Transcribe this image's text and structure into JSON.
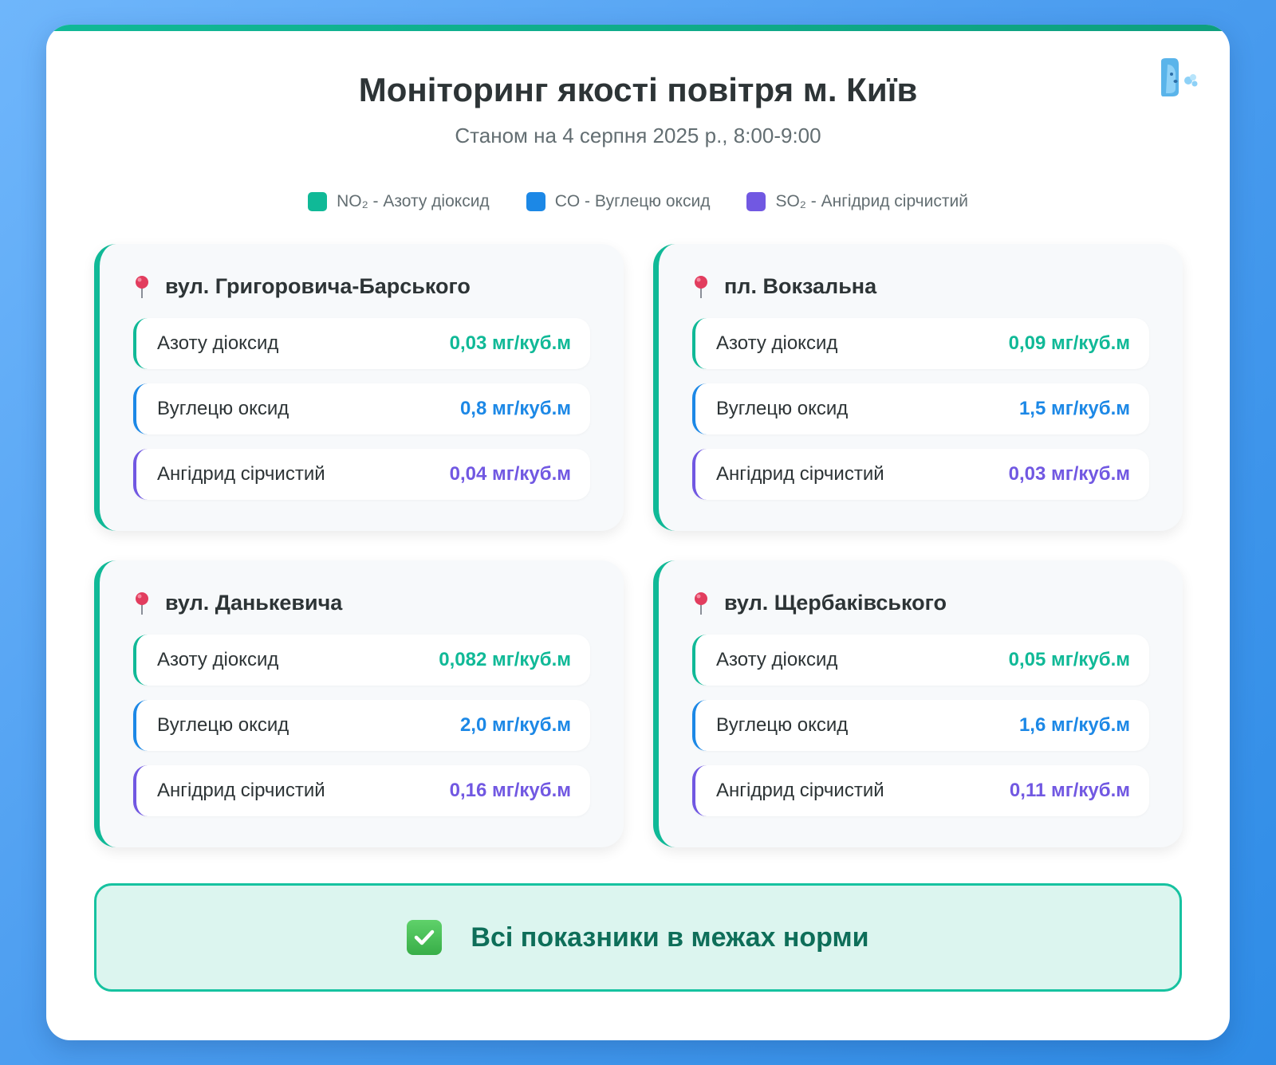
{
  "header": {
    "title": "Моніторинг якості повітря м. Київ",
    "subtitle": "Станом на 4 серпня 2025 р., 8:00-9:00"
  },
  "legend": [
    {
      "label": "NO₂ - Азоту діоксид",
      "color": "#10b997"
    },
    {
      "label": "CO - Вуглецю оксид",
      "color": "#1c88e6"
    },
    {
      "label": "SO₂ - Ангідрид сірчистий",
      "color": "#7158e2"
    }
  ],
  "icons": {
    "logo": "face-wind-icon",
    "location": "round-pushpin-icon",
    "status": "check-mark-button-icon"
  },
  "stations": [
    {
      "name": "вул. Григоровича-Барського",
      "rows": [
        {
          "label": "Азоту діоксид",
          "value": "0,03 мг/куб.м"
        },
        {
          "label": "Вуглецю оксид",
          "value": "0,8 мг/куб.м"
        },
        {
          "label": "Ангідрид сірчистий",
          "value": "0,04 мг/куб.м"
        }
      ]
    },
    {
      "name": "пл. Вокзальна",
      "rows": [
        {
          "label": "Азоту діоксид",
          "value": "0,09 мг/куб.м"
        },
        {
          "label": "Вуглецю оксид",
          "value": "1,5 мг/куб.м"
        },
        {
          "label": "Ангідрид сірчистий",
          "value": "0,03 мг/куб.м"
        }
      ]
    },
    {
      "name": "вул. Данькевича",
      "rows": [
        {
          "label": "Азоту діоксид",
          "value": "0,082 мг/куб.м"
        },
        {
          "label": "Вуглецю оксид",
          "value": "2,0 мг/куб.м"
        },
        {
          "label": "Ангідрид сірчистий",
          "value": "0,16 мг/куб.м"
        }
      ]
    },
    {
      "name": "вул. Щербаківського",
      "rows": [
        {
          "label": "Азоту діоксид",
          "value": "0,05 мг/куб.м"
        },
        {
          "label": "Вуглецю оксид",
          "value": "1,6 мг/куб.м"
        },
        {
          "label": "Ангідрид сірчистий",
          "value": "0,11 мг/куб.м"
        }
      ]
    }
  ],
  "status": {
    "text": "Всі показники в межах норми"
  }
}
